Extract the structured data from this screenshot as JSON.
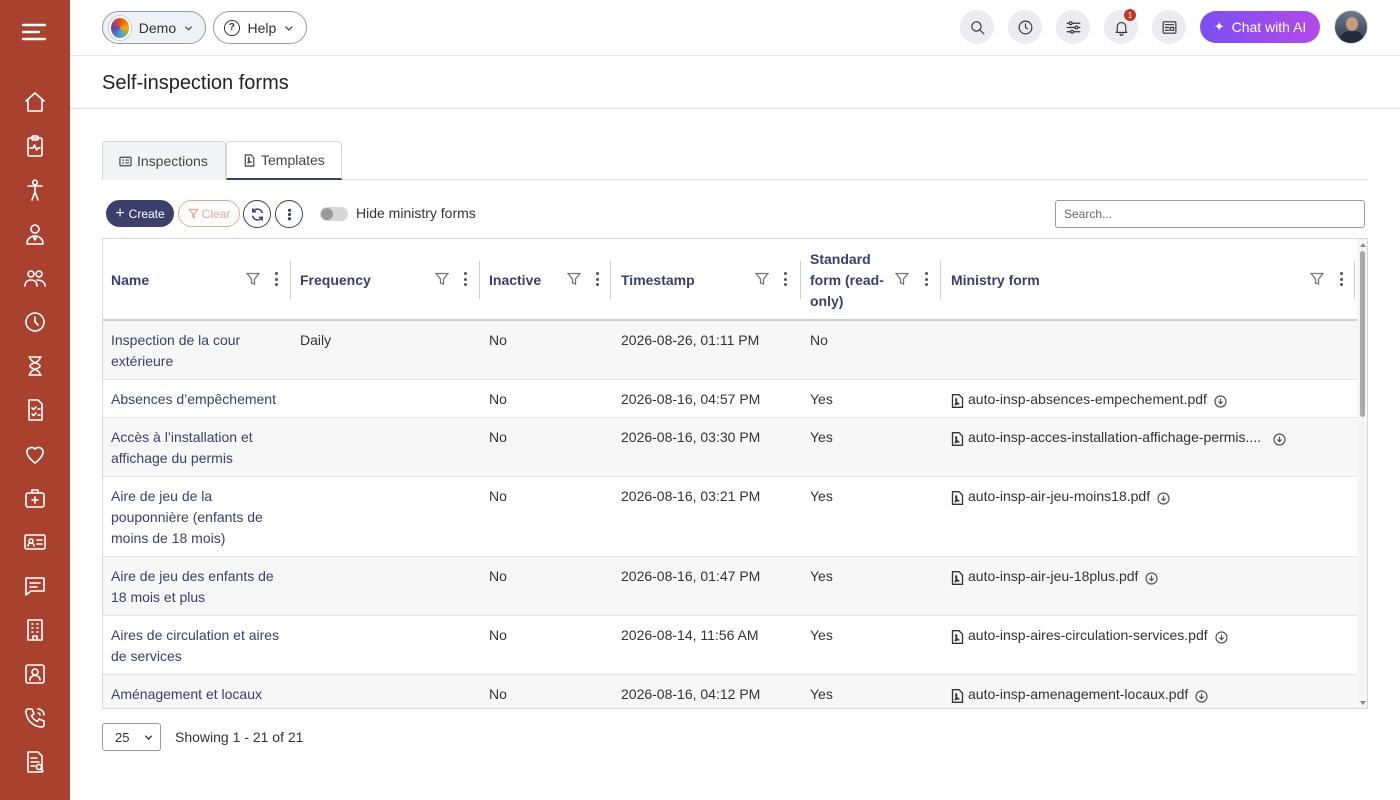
{
  "topbar": {
    "org_label": "Demo",
    "help_label": "Help",
    "notifications_count": "1",
    "chat_label": "Chat with AI"
  },
  "page": {
    "title": "Self-inspection forms"
  },
  "tabs": [
    {
      "label": "Inspections",
      "active": false
    },
    {
      "label": "Templates",
      "active": true
    }
  ],
  "toolbar": {
    "create_label": "Create",
    "clear_label": "Clear",
    "hide_ministry_label": "Hide ministry forms",
    "hide_ministry_on": false,
    "search_placeholder": "Search..."
  },
  "grid": {
    "columns": [
      "Name",
      "Frequency",
      "Inactive",
      "Timestamp",
      "Standard form (read-only)",
      "Ministry form"
    ],
    "rows": [
      {
        "name": "Inspection de la cour extérieure",
        "frequency": "Daily",
        "inactive": "No",
        "timestamp": "2026-08-26, 01:11 PM",
        "standard": "No",
        "ministry_file": ""
      },
      {
        "name": "Absences d’empêchement",
        "frequency": "",
        "inactive": "No",
        "timestamp": "2026-08-16, 04:57 PM",
        "standard": "Yes",
        "ministry_file": "auto-insp-absences-empechement.pdf"
      },
      {
        "name": "Accès à l’installation et affichage du permis",
        "frequency": "",
        "inactive": "No",
        "timestamp": "2026-08-16, 03:30 PM",
        "standard": "Yes",
        "ministry_file": "auto-insp-acces-installation-affichage-permis...."
      },
      {
        "name": "Aire de jeu de la pouponnière (enfants de moins de 18 mois)",
        "frequency": "",
        "inactive": "No",
        "timestamp": "2026-08-16, 03:21 PM",
        "standard": "Yes",
        "ministry_file": "auto-insp-air-jeu-moins18.pdf"
      },
      {
        "name": "Aire de jeu des enfants de 18 mois et plus",
        "frequency": "",
        "inactive": "No",
        "timestamp": "2026-08-16, 01:47 PM",
        "standard": "Yes",
        "ministry_file": "auto-insp-air-jeu-18plus.pdf"
      },
      {
        "name": "Aires de circulation et aires de services",
        "frequency": "",
        "inactive": "No",
        "timestamp": "2026-08-14, 11:56 AM",
        "standard": "Yes",
        "ministry_file": "auto-insp-aires-circulation-services.pdf"
      },
      {
        "name": "Aménagement et locaux",
        "frequency": "",
        "inactive": "No",
        "timestamp": "2026-08-16, 04:12 PM",
        "standard": "Yes",
        "ministry_file": "auto-insp-amenagement-locaux.pdf"
      }
    ]
  },
  "footer": {
    "page_size": "25",
    "paging_text": "Showing 1 - 21 of 21"
  },
  "colors": {
    "sidebar": "#a9412f",
    "primary": "#3a3f6b",
    "chat_gradient_start": "#7b4ff0",
    "chat_gradient_end": "#b34ae8",
    "clear_accent": "#e2a89c"
  },
  "sidebar_icons": [
    "home-icon",
    "clipboard-pulse-icon",
    "child-icon",
    "staff-icon",
    "group-icon",
    "clock-icon",
    "hourglass-icon",
    "checklist-icon",
    "heart-icon",
    "first-aid-icon",
    "id-card-icon",
    "chat-icon",
    "building-icon",
    "contact-card-icon",
    "phone-icon",
    "report-icon"
  ]
}
